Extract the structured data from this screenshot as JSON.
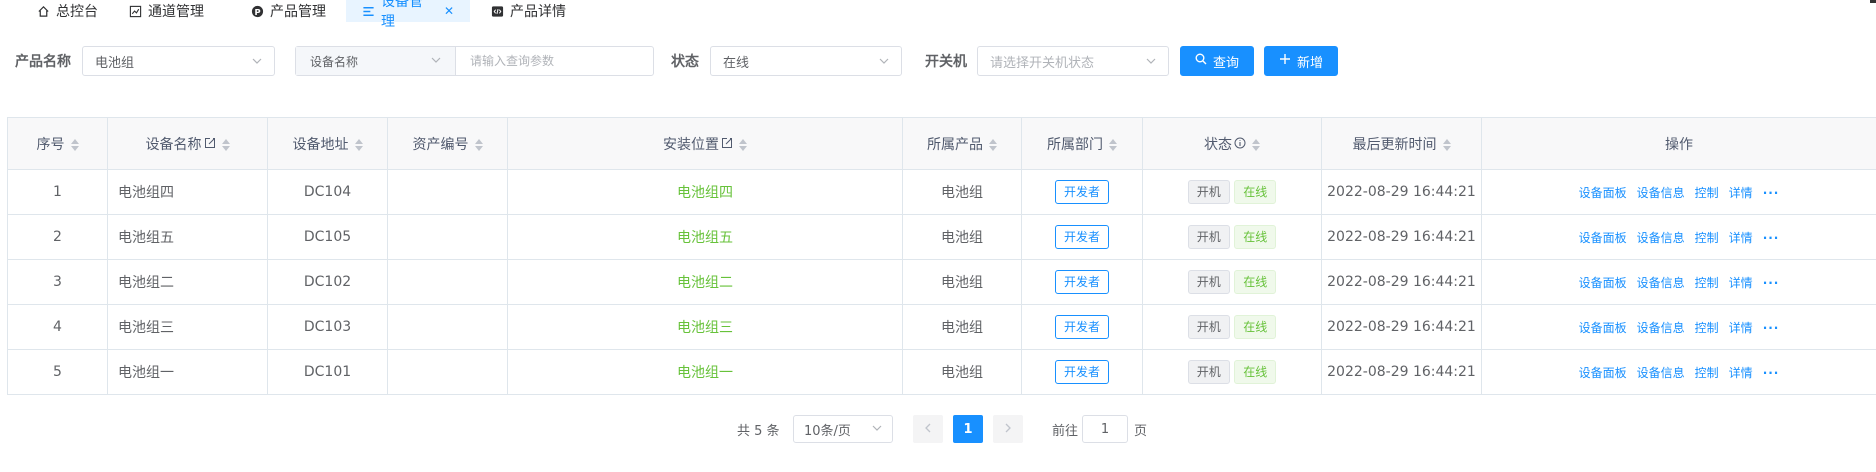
{
  "tabs": [
    {
      "label": "总控台",
      "icon": "home-icon"
    },
    {
      "label": "通道管理",
      "icon": "chart-icon"
    },
    {
      "label": "产品管理",
      "icon": "product-p-icon"
    },
    {
      "label": "设备管理",
      "icon": "list-icon",
      "active": true
    },
    {
      "label": "产品详情",
      "icon": "code-icon"
    }
  ],
  "filter": {
    "product_label": "产品名称",
    "product_value": "电池组",
    "device_prefix": "设备名称",
    "device_placeholder": "请输入查询参数",
    "status_label": "状态",
    "status_value": "在线",
    "switch_label": "开关机",
    "switch_placeholder": "请选择开关机状态",
    "query_label": "查询",
    "add_label": "新增"
  },
  "table": {
    "headers": {
      "index": "序号",
      "name": "设备名称",
      "address": "设备地址",
      "asset": "资产编号",
      "location": "安装位置",
      "product": "所属产品",
      "dept": "所属部门",
      "status": "状态",
      "updated": "最后更新时间",
      "ops": "操作"
    },
    "rows": [
      {
        "index": "1",
        "name": "电池组四",
        "address": "DC104",
        "asset": "",
        "location": "电池组四",
        "product": "电池组",
        "dept": "开发者",
        "power": "开机",
        "online": "在线",
        "updated": "2022-08-29 16:44:21"
      },
      {
        "index": "2",
        "name": "电池组五",
        "address": "DC105",
        "asset": "",
        "location": "电池组五",
        "product": "电池组",
        "dept": "开发者",
        "power": "开机",
        "online": "在线",
        "updated": "2022-08-29 16:44:21"
      },
      {
        "index": "3",
        "name": "电池组二",
        "address": "DC102",
        "asset": "",
        "location": "电池组二",
        "product": "电池组",
        "dept": "开发者",
        "power": "开机",
        "online": "在线",
        "updated": "2022-08-29 16:44:21"
      },
      {
        "index": "4",
        "name": "电池组三",
        "address": "DC103",
        "asset": "",
        "location": "电池组三",
        "product": "电池组",
        "dept": "开发者",
        "power": "开机",
        "online": "在线",
        "updated": "2022-08-29 16:44:21"
      },
      {
        "index": "5",
        "name": "电池组一",
        "address": "DC101",
        "asset": "",
        "location": "电池组一",
        "product": "电池组",
        "dept": "开发者",
        "power": "开机",
        "online": "在线",
        "updated": "2022-08-29 16:44:21"
      }
    ],
    "ops": {
      "panel": "设备面板",
      "info": "设备信息",
      "control": "控制",
      "detail": "详情",
      "more": "···"
    }
  },
  "pager": {
    "total": "共 5 条",
    "page_size": "10条/页",
    "current": "1",
    "goto_prefix": "前往",
    "goto_value": "1",
    "goto_suffix": "页"
  },
  "colors": {
    "primary": "#1890ff",
    "success": "#67c23a"
  }
}
